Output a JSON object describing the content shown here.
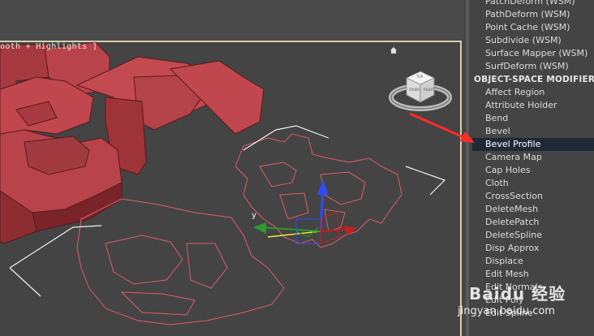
{
  "viewport": {
    "label": "ooth + Highlights ]",
    "axis_y_label": "y",
    "accent_arrow_color": "#ff2a2a",
    "mesh_color": "#c0474d",
    "spline_color": "#e05a6a"
  },
  "viewcube": {
    "top_label": "TOP",
    "front_label": "FRONT",
    "right_label": "RIGHT"
  },
  "modifier_list": {
    "items": [
      "PatchDeform (WSM)",
      "PathDeform (WSM)",
      "Point Cache (WSM)",
      "Subdivide (WSM)",
      "Surface Mapper (WSM)",
      "SurfDeform (WSM)"
    ],
    "section_header": "OBJECT-SPACE MODIFIERS",
    "object_items": [
      "Affect Region",
      "Attribute Holder",
      "Bend",
      "Bevel",
      "Bevel Profile",
      "Camera Map",
      "Cap Holes",
      "Cloth",
      "CrossSection",
      "DeleteMesh",
      "DeletePatch",
      "DeleteSpline",
      "Disp Approx",
      "Displace",
      "Edit Mesh",
      "Edit Normals",
      "Edit Poly",
      "Edit Spline"
    ],
    "selected": "Bevel Profile"
  },
  "watermark": {
    "logo": "Baidu 经验",
    "url": "jingyan.baidu.com"
  }
}
